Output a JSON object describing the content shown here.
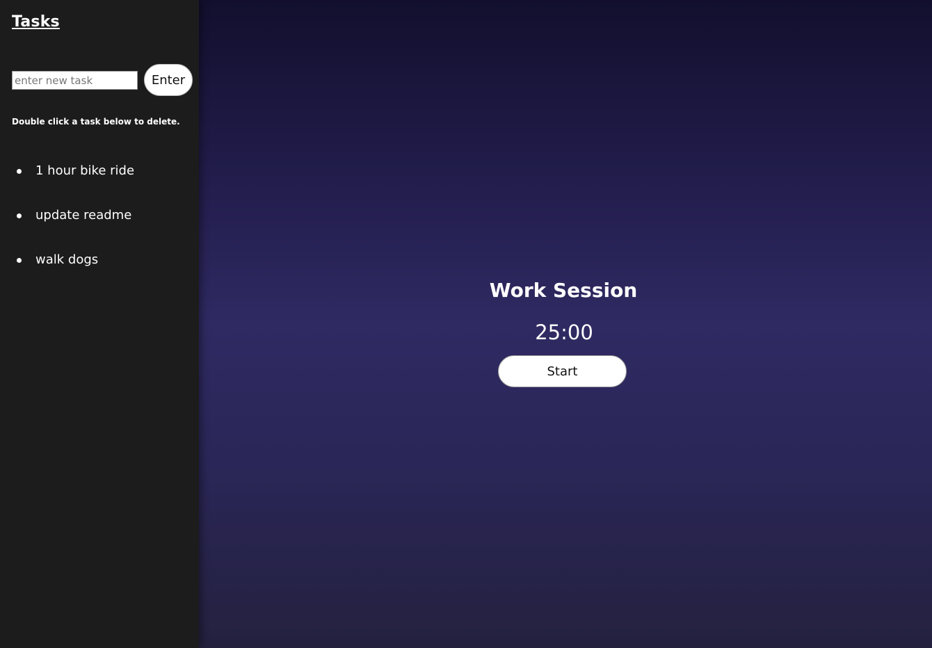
{
  "sidebar": {
    "title": "Tasks",
    "input_placeholder": "enter new task",
    "input_value": "",
    "enter_label": "Enter",
    "hint": "Double click a task below to delete.",
    "tasks": [
      {
        "label": "1 hour bike ride"
      },
      {
        "label": "update readme"
      },
      {
        "label": "walk dogs"
      }
    ]
  },
  "main": {
    "session_title": "Work Session",
    "timer": "25:00",
    "start_label": "Start"
  },
  "colors": {
    "sidebar_background": "#1c1c1c",
    "main_gradient_top": "#120f2e",
    "main_gradient_middle": "#2f2a62",
    "main_gradient_bottom": "#24213f",
    "button_background": "#ffffff",
    "text": "#ffffff"
  },
  "icons": {
    "task_bullet": "bullet-dot-icon"
  }
}
